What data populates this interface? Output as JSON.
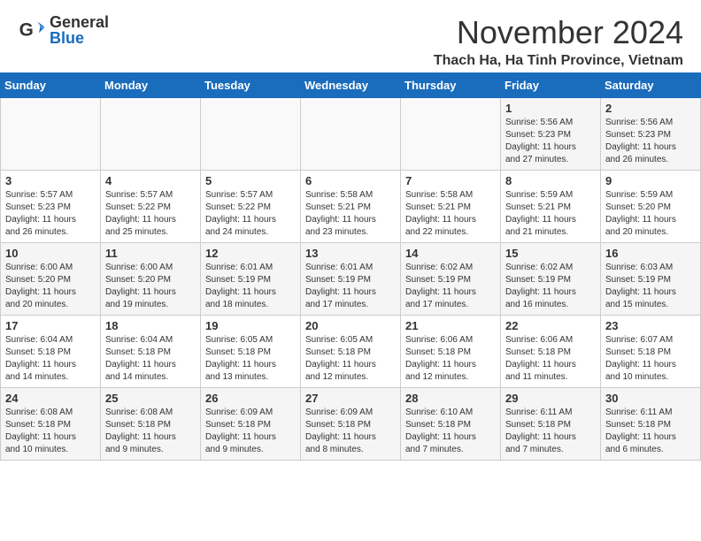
{
  "header": {
    "logo_general": "General",
    "logo_blue": "Blue",
    "month_title": "November 2024",
    "location": "Thach Ha, Ha Tinh Province, Vietnam"
  },
  "calendar": {
    "headers": [
      "Sunday",
      "Monday",
      "Tuesday",
      "Wednesday",
      "Thursday",
      "Friday",
      "Saturday"
    ],
    "rows": [
      [
        {
          "num": "",
          "info": ""
        },
        {
          "num": "",
          "info": ""
        },
        {
          "num": "",
          "info": ""
        },
        {
          "num": "",
          "info": ""
        },
        {
          "num": "",
          "info": ""
        },
        {
          "num": "1",
          "info": "Sunrise: 5:56 AM\nSunset: 5:23 PM\nDaylight: 11 hours\nand 27 minutes."
        },
        {
          "num": "2",
          "info": "Sunrise: 5:56 AM\nSunset: 5:23 PM\nDaylight: 11 hours\nand 26 minutes."
        }
      ],
      [
        {
          "num": "3",
          "info": "Sunrise: 5:57 AM\nSunset: 5:23 PM\nDaylight: 11 hours\nand 26 minutes."
        },
        {
          "num": "4",
          "info": "Sunrise: 5:57 AM\nSunset: 5:22 PM\nDaylight: 11 hours\nand 25 minutes."
        },
        {
          "num": "5",
          "info": "Sunrise: 5:57 AM\nSunset: 5:22 PM\nDaylight: 11 hours\nand 24 minutes."
        },
        {
          "num": "6",
          "info": "Sunrise: 5:58 AM\nSunset: 5:21 PM\nDaylight: 11 hours\nand 23 minutes."
        },
        {
          "num": "7",
          "info": "Sunrise: 5:58 AM\nSunset: 5:21 PM\nDaylight: 11 hours\nand 22 minutes."
        },
        {
          "num": "8",
          "info": "Sunrise: 5:59 AM\nSunset: 5:21 PM\nDaylight: 11 hours\nand 21 minutes."
        },
        {
          "num": "9",
          "info": "Sunrise: 5:59 AM\nSunset: 5:20 PM\nDaylight: 11 hours\nand 20 minutes."
        }
      ],
      [
        {
          "num": "10",
          "info": "Sunrise: 6:00 AM\nSunset: 5:20 PM\nDaylight: 11 hours\nand 20 minutes."
        },
        {
          "num": "11",
          "info": "Sunrise: 6:00 AM\nSunset: 5:20 PM\nDaylight: 11 hours\nand 19 minutes."
        },
        {
          "num": "12",
          "info": "Sunrise: 6:01 AM\nSunset: 5:19 PM\nDaylight: 11 hours\nand 18 minutes."
        },
        {
          "num": "13",
          "info": "Sunrise: 6:01 AM\nSunset: 5:19 PM\nDaylight: 11 hours\nand 17 minutes."
        },
        {
          "num": "14",
          "info": "Sunrise: 6:02 AM\nSunset: 5:19 PM\nDaylight: 11 hours\nand 17 minutes."
        },
        {
          "num": "15",
          "info": "Sunrise: 6:02 AM\nSunset: 5:19 PM\nDaylight: 11 hours\nand 16 minutes."
        },
        {
          "num": "16",
          "info": "Sunrise: 6:03 AM\nSunset: 5:19 PM\nDaylight: 11 hours\nand 15 minutes."
        }
      ],
      [
        {
          "num": "17",
          "info": "Sunrise: 6:04 AM\nSunset: 5:18 PM\nDaylight: 11 hours\nand 14 minutes."
        },
        {
          "num": "18",
          "info": "Sunrise: 6:04 AM\nSunset: 5:18 PM\nDaylight: 11 hours\nand 14 minutes."
        },
        {
          "num": "19",
          "info": "Sunrise: 6:05 AM\nSunset: 5:18 PM\nDaylight: 11 hours\nand 13 minutes."
        },
        {
          "num": "20",
          "info": "Sunrise: 6:05 AM\nSunset: 5:18 PM\nDaylight: 11 hours\nand 12 minutes."
        },
        {
          "num": "21",
          "info": "Sunrise: 6:06 AM\nSunset: 5:18 PM\nDaylight: 11 hours\nand 12 minutes."
        },
        {
          "num": "22",
          "info": "Sunrise: 6:06 AM\nSunset: 5:18 PM\nDaylight: 11 hours\nand 11 minutes."
        },
        {
          "num": "23",
          "info": "Sunrise: 6:07 AM\nSunset: 5:18 PM\nDaylight: 11 hours\nand 10 minutes."
        }
      ],
      [
        {
          "num": "24",
          "info": "Sunrise: 6:08 AM\nSunset: 5:18 PM\nDaylight: 11 hours\nand 10 minutes."
        },
        {
          "num": "25",
          "info": "Sunrise: 6:08 AM\nSunset: 5:18 PM\nDaylight: 11 hours\nand 9 minutes."
        },
        {
          "num": "26",
          "info": "Sunrise: 6:09 AM\nSunset: 5:18 PM\nDaylight: 11 hours\nand 9 minutes."
        },
        {
          "num": "27",
          "info": "Sunrise: 6:09 AM\nSunset: 5:18 PM\nDaylight: 11 hours\nand 8 minutes."
        },
        {
          "num": "28",
          "info": "Sunrise: 6:10 AM\nSunset: 5:18 PM\nDaylight: 11 hours\nand 7 minutes."
        },
        {
          "num": "29",
          "info": "Sunrise: 6:11 AM\nSunset: 5:18 PM\nDaylight: 11 hours\nand 7 minutes."
        },
        {
          "num": "30",
          "info": "Sunrise: 6:11 AM\nSunset: 5:18 PM\nDaylight: 11 hours\nand 6 minutes."
        }
      ]
    ]
  }
}
